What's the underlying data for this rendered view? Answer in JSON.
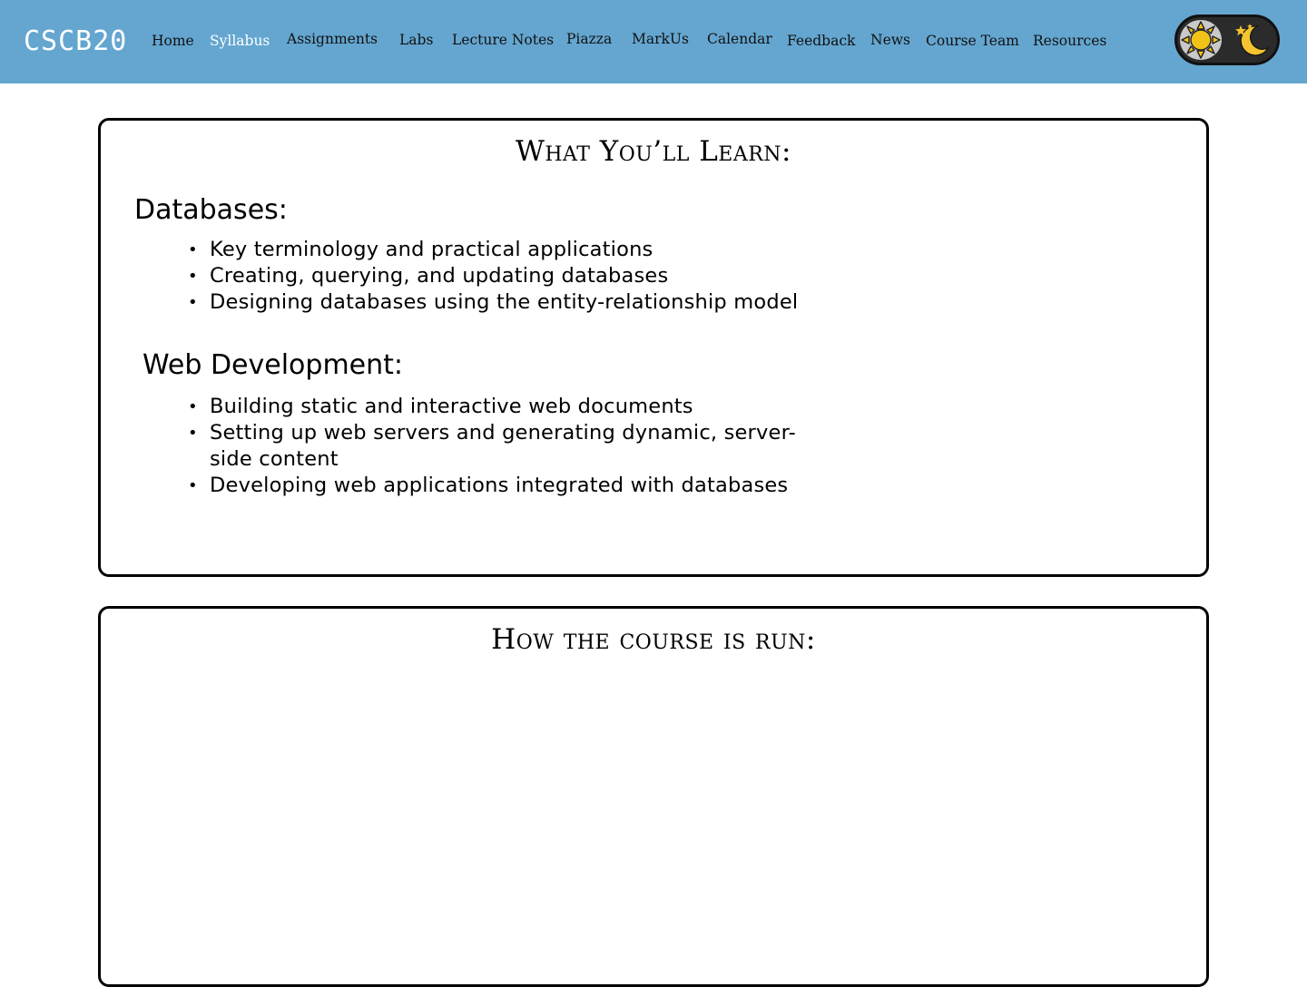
{
  "brand": "CSCB20",
  "nav": {
    "items": [
      {
        "label": "Home",
        "active": false
      },
      {
        "label": "Syllabus",
        "active": true
      },
      {
        "label": "Assignments",
        "active": false
      },
      {
        "label": "Labs",
        "active": false
      },
      {
        "label": "Lecture Notes",
        "active": false
      },
      {
        "label": "Piazza",
        "active": false
      },
      {
        "label": "MarkUs",
        "active": false
      },
      {
        "label": "Calendar",
        "active": false
      },
      {
        "label": "Feedback",
        "active": false
      },
      {
        "label": "News",
        "active": false
      },
      {
        "label": "Course Team",
        "active": false
      },
      {
        "label": "Resources",
        "active": false
      }
    ]
  },
  "theme_toggle": {
    "light_icon": "sun-icon",
    "dark_icon": "moon-icon"
  },
  "learn_card": {
    "title": "What You’ll Learn:",
    "sections": [
      {
        "heading": "Databases:",
        "items": [
          "Key terminology and practical applications",
          "Creating, querying, and updating databases",
          "Designing databases using the entity-relationship model"
        ]
      },
      {
        "heading": "Web Development:",
        "items": [
          "Building static and interactive web documents",
          "Setting up web servers and generating dynamic, server-side content",
          "Developing web applications integrated with databases"
        ]
      }
    ]
  },
  "run_card": {
    "title": "How the course is run:"
  },
  "colors": {
    "navbar": "#64a6d0",
    "active_link": "#ffffff",
    "card_border": "#000000"
  }
}
